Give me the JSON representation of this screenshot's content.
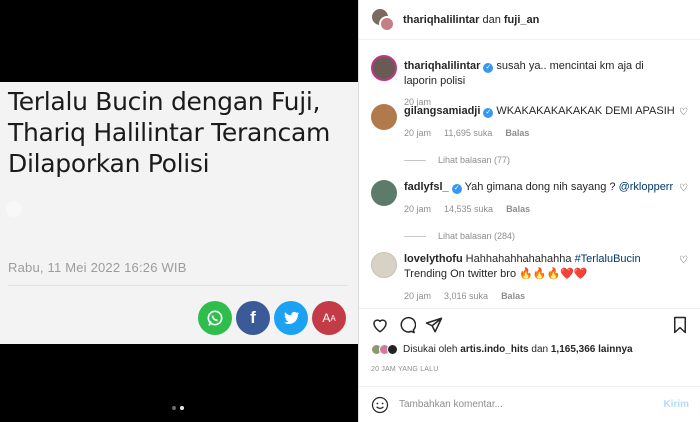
{
  "article": {
    "headline": "Terlalu Bucin dengan Fuji, Thariq Halilintar Terancam Dilaporkan Polisi",
    "date": "Rabu, 11 Mei 2022 16:26 WIB",
    "share": {
      "whatsapp": "whatsapp-icon",
      "facebook_label": "f",
      "twitter": "twitter-icon",
      "font_size_label": "A"
    }
  },
  "carousel": {
    "count": 2,
    "active": 2
  },
  "header": {
    "user1": "thariqhalilintar",
    "joiner": "dan",
    "user2": "fuji_an"
  },
  "caption": {
    "user": "thariqhalilintar",
    "text": "susah ya.. mencintai km aja di laporin polisi",
    "time": "20 jam"
  },
  "comments": [
    {
      "user": "gilangsamiadji",
      "verified": true,
      "text": "WKAKAKAKAKAKAK DEMI APASIH",
      "time": "20 jam",
      "likes": "11,695 suka",
      "reply": "Balas",
      "view_replies": "Lihat balasan (77)"
    },
    {
      "user": "fadlyfsl_",
      "verified": true,
      "text": "Yah gimana dong nih sayang ?",
      "mention": "@rklopperr",
      "time": "20 jam",
      "likes": "14,535 suka",
      "reply": "Balas",
      "view_replies": "Lihat balasan (284)"
    },
    {
      "user": "lovelythofu",
      "verified": false,
      "text_before": "Hahhahahhahahahha",
      "hashtag": "#TerlaluBucin",
      "text_after": "Trending On twitter bro 🔥🔥🔥❤️❤️",
      "time": "20 jam",
      "likes": "3,016 suka",
      "reply": "Balas"
    }
  ],
  "likes": {
    "prefix": "Disukai oleh",
    "user": "artis.indo_hits",
    "joiner": "dan",
    "count": "1,165,366 lainnya"
  },
  "post_time": "20 JAM YANG LALU",
  "add_comment": {
    "placeholder": "Tambahkan komentar...",
    "post_label": "Kirim"
  },
  "colors": {
    "verified": "#3897f0",
    "link": "#00376b",
    "whatsapp": "#2fbe4d",
    "facebook": "#3b5a98",
    "twitter": "#1da1f2",
    "font_btn": "#c23b46"
  }
}
